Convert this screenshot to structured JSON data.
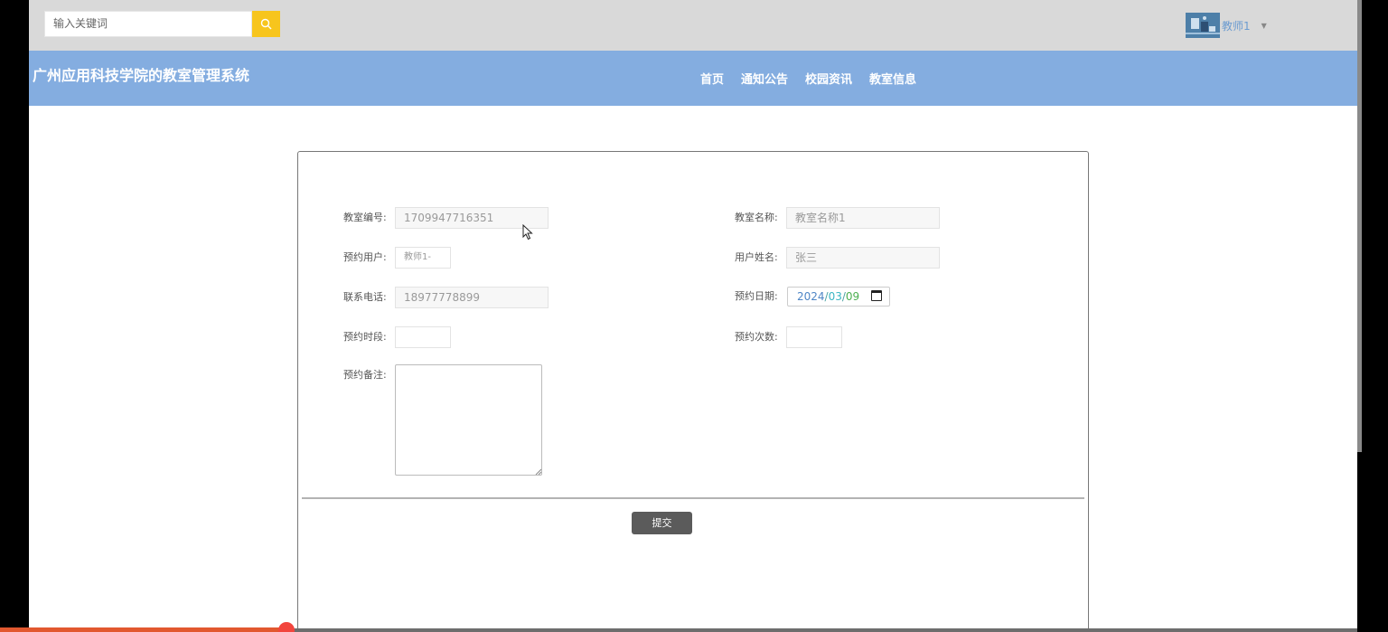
{
  "search": {
    "placeholder": "输入关键词"
  },
  "user": {
    "name": "教师1"
  },
  "site": {
    "title": "广州应用科技学院的教室管理系统"
  },
  "nav": {
    "items": [
      "首页",
      "通知公告",
      "校园资讯",
      "教室信息"
    ]
  },
  "form": {
    "classroom_no": {
      "label": "教室编号:",
      "value": "1709947716351"
    },
    "classroom_name": {
      "label": "教室名称:",
      "value": "教室名称1"
    },
    "booking_user": {
      "label": "预约用户:",
      "value": "教师1-"
    },
    "user_realname": {
      "label": "用户姓名:",
      "value": "张三"
    },
    "phone": {
      "label": "联系电话:",
      "value": "18977778899"
    },
    "booking_date": {
      "label": "预约日期:",
      "year": "2024",
      "month": "03",
      "day": "09",
      "sep": "/"
    },
    "time_slot": {
      "label": "预约时段:",
      "value": ""
    },
    "booking_count": {
      "label": "预约次数:",
      "value": ""
    },
    "remark": {
      "label": "预约备注:",
      "value": ""
    },
    "submit_label": "提交"
  },
  "colors": {
    "topbar": "#d9d9d9",
    "navbar": "#84ade0",
    "search_button": "#f7c51d",
    "submit_button": "#5b5b5b",
    "progress": "#e2582f"
  },
  "icons": {
    "search": "search-icon",
    "calendar": "calendar-icon",
    "caret": "chevron-down-icon"
  }
}
